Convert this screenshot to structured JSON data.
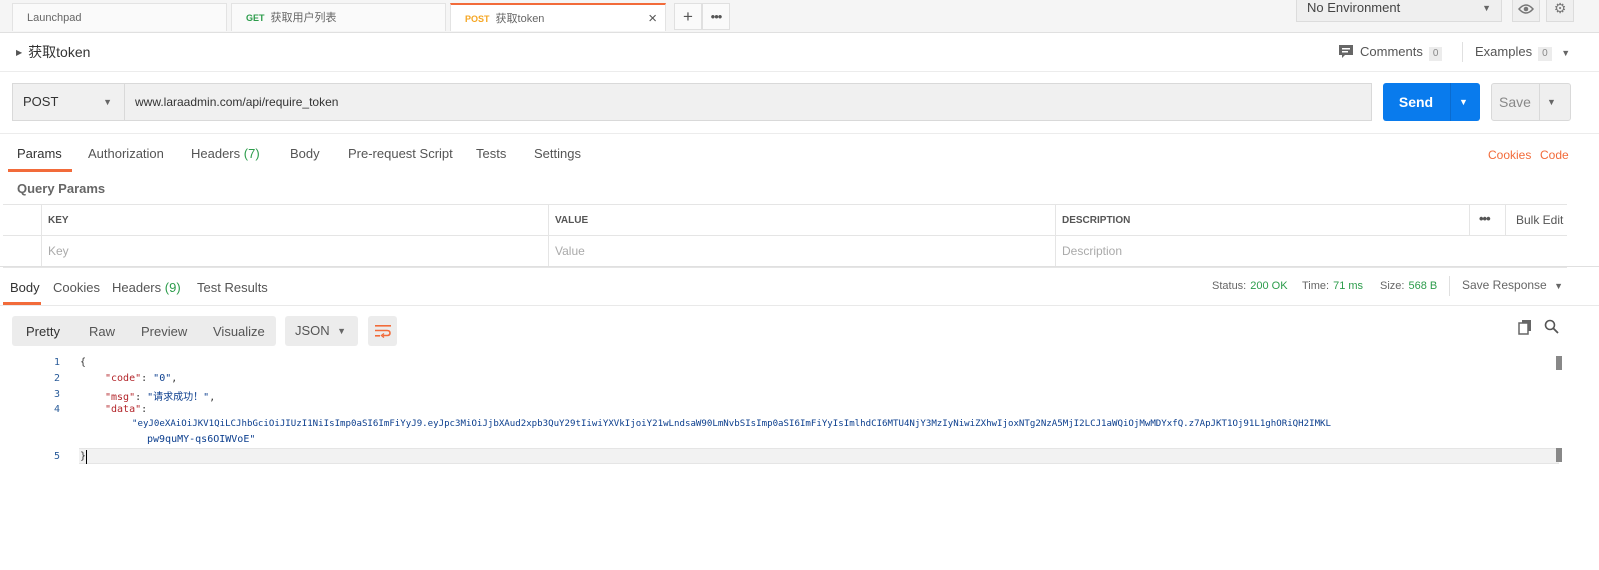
{
  "tabs": [
    {
      "method": "",
      "label": "Launchpad"
    },
    {
      "method": "GET",
      "label": "获取用户列表"
    },
    {
      "method": "POST",
      "label": "获取token"
    }
  ],
  "environment": "No Environment",
  "request": {
    "name": "获取token",
    "method": "POST",
    "url": "www.laraadmin.com/api/require_token",
    "send_label": "Send",
    "save_label": "Save"
  },
  "meta": {
    "comments_label": "Comments",
    "comments_count": "0",
    "examples_label": "Examples",
    "examples_count": "0"
  },
  "request_tabs": {
    "params": "Params",
    "authorization": "Authorization",
    "headers": "Headers",
    "headers_count": "(7)",
    "body": "Body",
    "prerequest": "Pre-request Script",
    "tests": "Tests",
    "settings": "Settings",
    "cookies": "Cookies",
    "code": "Code"
  },
  "query_params": {
    "title": "Query Params",
    "columns": [
      "KEY",
      "VALUE",
      "DESCRIPTION"
    ],
    "placeholders": [
      "Key",
      "Value",
      "Description"
    ],
    "bulk_edit": "Bulk Edit"
  },
  "response_tabs": {
    "body": "Body",
    "cookies": "Cookies",
    "headers": "Headers",
    "headers_count": "(9)",
    "test_results": "Test Results"
  },
  "response_status": {
    "status_label": "Status:",
    "status_value": "200 OK",
    "time_label": "Time:",
    "time_value": "71 ms",
    "size_label": "Size:",
    "size_value": "568 B",
    "save_response": "Save Response"
  },
  "view": {
    "pretty": "Pretty",
    "raw": "Raw",
    "preview": "Preview",
    "visualize": "Visualize",
    "format": "JSON"
  },
  "response_body": {
    "line_numbers": [
      "1",
      "2",
      "3",
      "4",
      "5"
    ],
    "open_brace": "{",
    "close_brace": "}",
    "code_key": "\"code\"",
    "code_value": "\"0\"",
    "msg_key": "\"msg\"",
    "msg_value": "\"请求成功！\"",
    "data_key": "\"data\"",
    "data_value_line1": "\"eyJ0eXAiOiJKV1QiLCJhbGciOiJIUzI1NiIsImp0aSI6ImFiYyJ9.eyJpc3MiOiJjbXAud2xpb3QuY29tIiwiYXVkIjoiY21wLndsaW90LmNvbSIsImp0aSI6ImFiYyIsImlhdCI6MTU4NjY3MzIyNiwiZXhwIjoxNTg2NzA5MjI2LCJ1aWQiOjMwMDYxfQ.z7ApJKT1Oj91L1ghORiQH2IMKL",
    "data_value_line2": "pw9quMY-qs6OIWVoE\""
  }
}
